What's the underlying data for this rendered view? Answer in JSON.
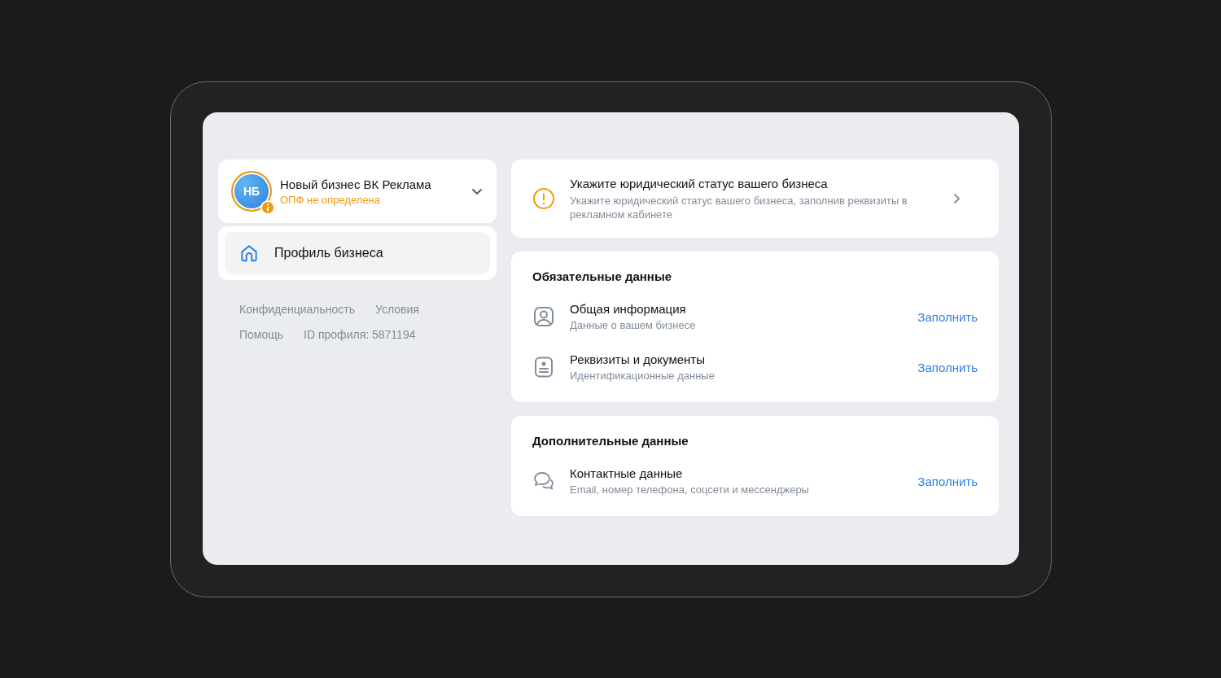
{
  "account": {
    "initials": "НБ",
    "name": "Новый бизнес ВК Реклама",
    "status": "ОПФ не определена"
  },
  "menu": [
    {
      "label": "Профиль бизнеса",
      "selected": true
    }
  ],
  "footer_links": [
    [
      "Конфиденциальность",
      "Условия"
    ],
    [
      "Помощь",
      "ID профиля: 5871194"
    ]
  ],
  "alert": {
    "title": "Укажите юридический статус вашего бизнеса",
    "text": "Укажите юридический статус вашего бизнеса, заполнив реквизиты в рекламном кабинете"
  },
  "sections": [
    {
      "title": "Обязательные данные",
      "items": [
        {
          "kind": "profile",
          "title": "Общая информация",
          "subtitle": "Данные о вашем бизнесе",
          "action": "Заполнить"
        },
        {
          "kind": "document",
          "title": "Реквизиты и документы",
          "subtitle": "Идентификационные данные",
          "action": "Заполнить"
        }
      ]
    },
    {
      "title": "Дополнительные данные",
      "items": [
        {
          "kind": "chat",
          "title": "Контактные данные",
          "subtitle": "Email, номер телефона, соцсети и мессенджеры",
          "action": "Заполнить"
        }
      ]
    }
  ]
}
